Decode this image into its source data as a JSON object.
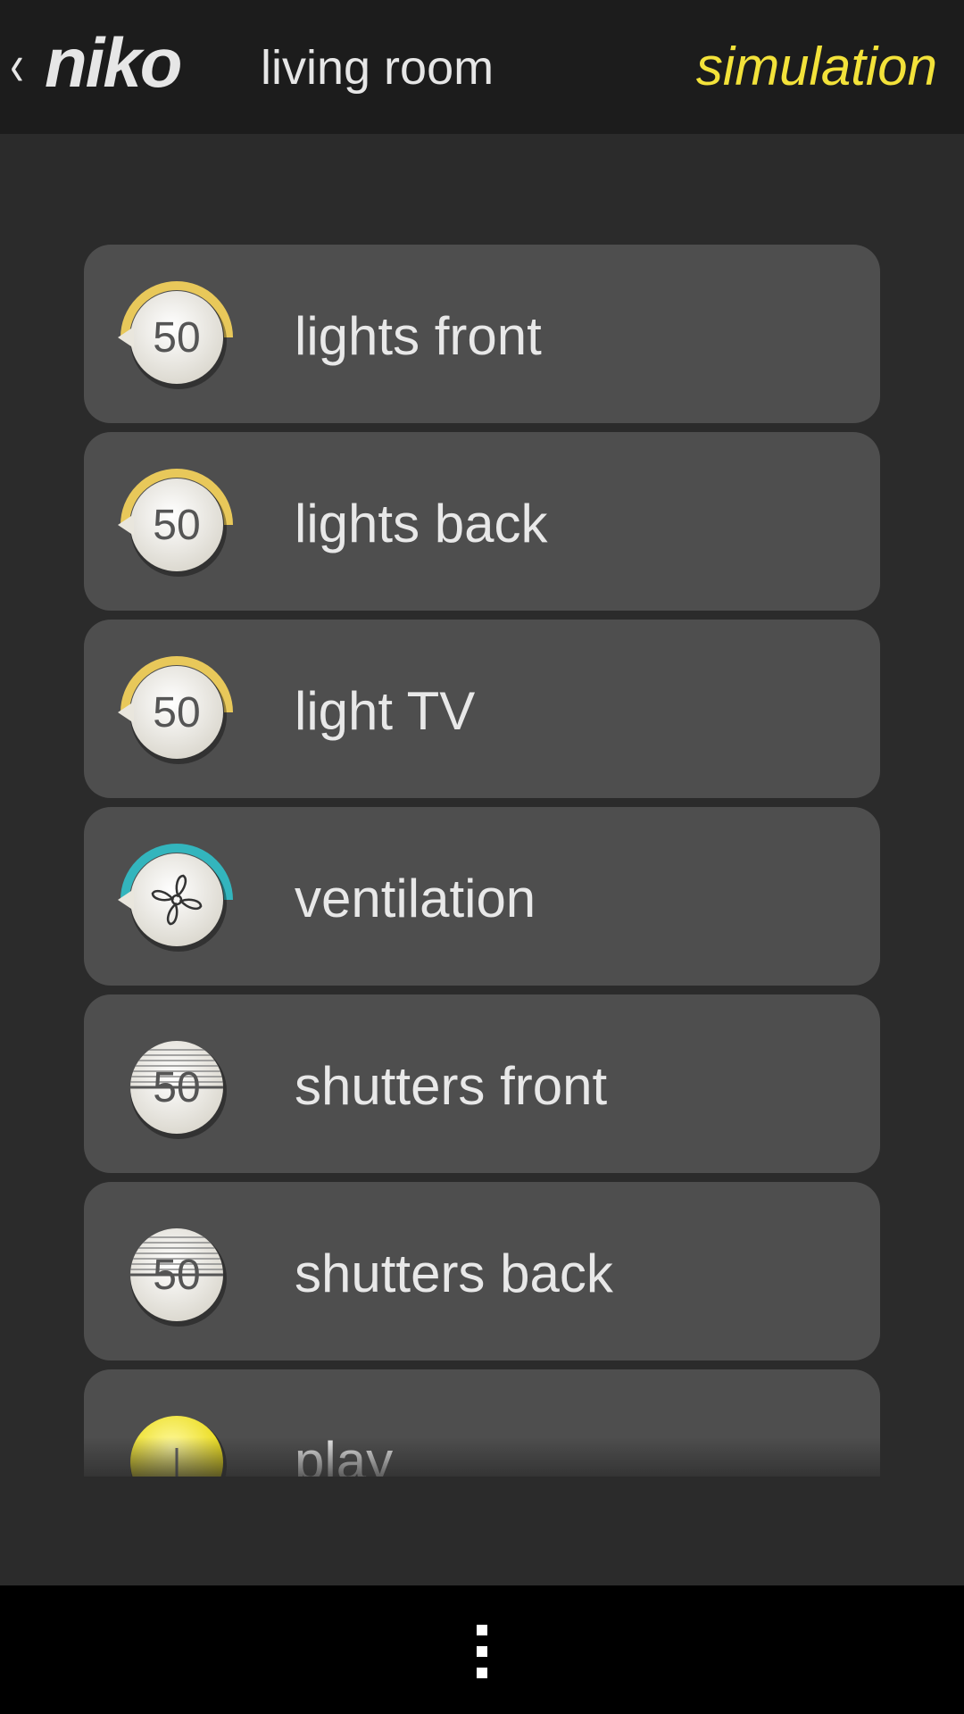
{
  "header": {
    "back_glyph": "‹",
    "logo_text": "niko",
    "title": "living room",
    "mode_label": "simulation"
  },
  "devices": [
    {
      "label": "lights front",
      "kind": "dimmer",
      "value": "50",
      "icon": "dimmer-dial-icon"
    },
    {
      "label": "lights back",
      "kind": "dimmer",
      "value": "50",
      "icon": "dimmer-dial-icon"
    },
    {
      "label": "light TV",
      "kind": "dimmer",
      "value": "50",
      "icon": "dimmer-dial-icon"
    },
    {
      "label": "ventilation",
      "kind": "fan",
      "value": "",
      "icon": "fan-icon"
    },
    {
      "label": "shutters front",
      "kind": "shutter",
      "value": "50",
      "icon": "shutter-icon"
    },
    {
      "label": "shutters back",
      "kind": "shutter",
      "value": "50",
      "icon": "shutter-icon"
    },
    {
      "label": "play",
      "kind": "switch",
      "value": "",
      "icon": "power-icon"
    }
  ],
  "colors": {
    "accent_yellow": "#f3e23a",
    "dimmer_ring": "#e8c85a",
    "fan_ring": "#33b5bd",
    "card_bg": "#4e4e4e",
    "page_bg": "#2b2b2b"
  },
  "navbar": {
    "icon": "overflow-menu-icon"
  }
}
